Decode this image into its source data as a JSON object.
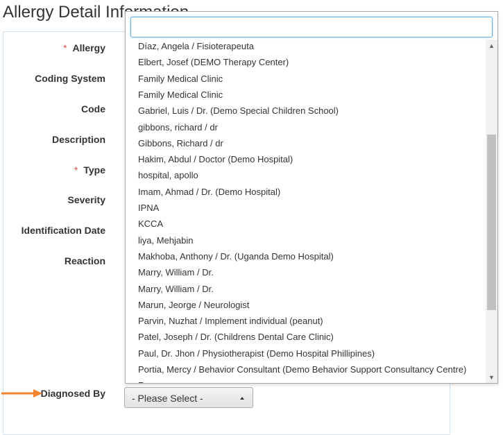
{
  "page": {
    "title": "Allergy Detail Information"
  },
  "form": {
    "labels": {
      "allergy": "Allergy",
      "coding_system": "Coding System",
      "code": "Code",
      "description": "Description",
      "type": "Type",
      "severity": "Severity",
      "identification_date": "Identification Date",
      "reaction": "Reaction",
      "diagnosed_by": "Diagnosed By"
    },
    "required_marker": "*",
    "diagnosed_by_select": {
      "selected": "- Please Select -"
    }
  },
  "dropdown": {
    "search": {
      "value": ""
    },
    "results": [
      "Díaz, Angela / Fisioterapeuta",
      "Elbert, Josef (DEMO Therapy Center)",
      "Family Medical Clinic",
      "Family Medical Clinic",
      "Gabriel, Luis / Dr. (Demo Special Children School)",
      "gibbons, richard / dr",
      "Gibbons, Richard / dr",
      "Hakim, Abdul / Doctor (Demo Hospital)",
      "hospital, apollo",
      "Imam, Ahmad / Dr. (Demo Hospital)",
      "IPNA",
      "KCCA",
      "liya, Mehjabin",
      "Makhoba, Anthony / Dr. (Uganda Demo Hospital)",
      "Marry, William / Dr.",
      "Marry, William / Dr.",
      "Marun, Jeorge / Neurologist",
      "Parvin, Nuzhat / Implement individual (peanut)",
      "Patel, Joseph / Dr. (Childrens Dental Care Clinic)",
      "Paul, Dr. Jhon / Physiotherapist (Demo Hospital Phillipines)",
      "Portia, Mercy / Behavior Consultant (Demo Behavior Support Consultancy Centre)",
      "Ram, ..."
    ]
  },
  "colors": {
    "accent_arrow": "#f0852d",
    "required": "#d9534f",
    "focus_border": "#66afe9"
  }
}
